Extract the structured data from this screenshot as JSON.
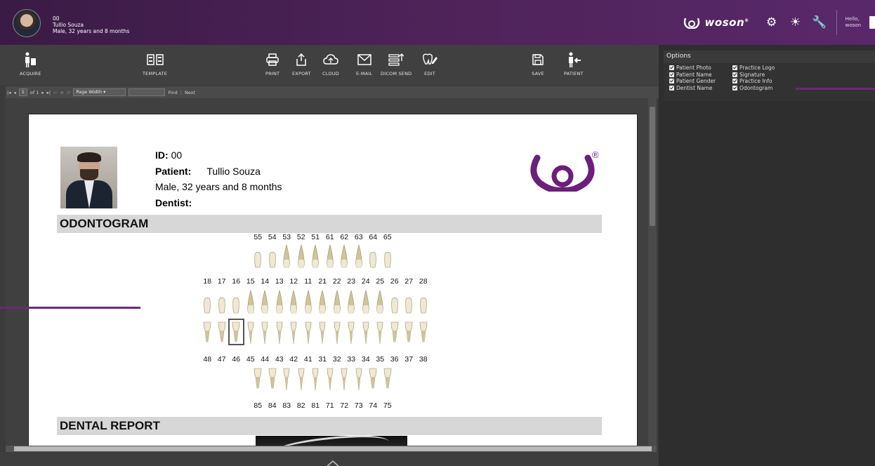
{
  "patient": {
    "id": "00",
    "name": "Tullio Souza",
    "summary": "Male, 32 years and 8 months"
  },
  "header": {
    "brand": "woson",
    "registered": "®",
    "hello": "Hello,",
    "username": "woson"
  },
  "toolbar": {
    "acquire": "ACQUIRE",
    "template": "TEMPLATE",
    "print": "PRINT",
    "export": "EXPORT",
    "cloud": "CLOUD",
    "email": "E-MAIL",
    "dicom_send": "DICOM SEND",
    "edit": "EDIT",
    "save": "SAVE",
    "patient": "PATIENT"
  },
  "viewer_nav": {
    "page_current": "1",
    "page_of": "of 1",
    "zoom": "Page Width",
    "find": "Find",
    "next": "Next"
  },
  "report": {
    "id_label": "ID:",
    "id_value": "00",
    "patient_label": "Patient:",
    "patient_value": "Tullio Souza",
    "summary": "Male, 32 years and 8 months",
    "dentist_label": "Dentist:",
    "section_odontogram": "ODONTOGRAM",
    "section_dental_report": "DENTAL REPORT",
    "upper_primary": [
      "55",
      "54",
      "53",
      "52",
      "51",
      "61",
      "62",
      "63",
      "64",
      "65"
    ],
    "upper_permanent": [
      "18",
      "17",
      "16",
      "15",
      "14",
      "13",
      "12",
      "11",
      "21",
      "22",
      "23",
      "24",
      "25",
      "26",
      "27",
      "28"
    ],
    "lower_permanent": [
      "48",
      "47",
      "46",
      "45",
      "44",
      "43",
      "42",
      "41",
      "31",
      "32",
      "33",
      "34",
      "35",
      "36",
      "37",
      "38"
    ],
    "lower_primary": [
      "85",
      "84",
      "83",
      "82",
      "81",
      "71",
      "72",
      "73",
      "74",
      "75"
    ],
    "selected_tooth": "46"
  },
  "options": {
    "title": "Options",
    "col1": [
      "Patient Photo",
      "Patient Name",
      "Patient Gender",
      "Dentist Name"
    ],
    "col2": [
      "Practice Logo",
      "Signature",
      "Practice Info",
      "Odontogram"
    ]
  },
  "colors": {
    "accent": "#6a2a7a",
    "topbar": "#4e2359",
    "logo": "#6b1f7a"
  }
}
